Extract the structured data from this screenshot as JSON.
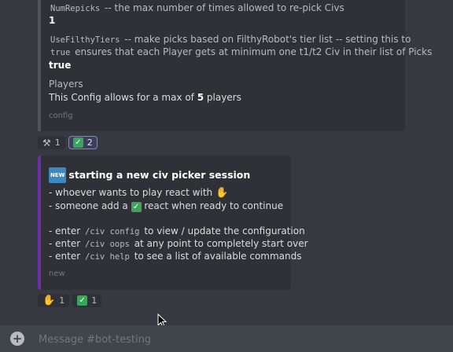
{
  "embed1": {
    "line1_code": "NumRepicks",
    "line1_text": " -- the max number of times allowed to re-pick Civs",
    "line1_value": "1",
    "line2_code": "UseFilthyTiers",
    "line2_text": " -- make picks based on FilthyRobot's tier list -- setting this to",
    "line3_code": "true",
    "line3_text": " ensures that each Player gets at minimum one t1/t2 Civ in their list of Picks",
    "line3_value": "true",
    "players_label": "Players",
    "players_pre": "This Config allows for a max of ",
    "players_num": "5",
    "players_post": " players",
    "footer": "config"
  },
  "reactions1": [
    {
      "icon": "tools-icon",
      "count": "1"
    },
    {
      "icon": "check-icon",
      "count": "2"
    }
  ],
  "embed2": {
    "badge": "NEW",
    "title": "starting a new civ picker session",
    "l1": "- whoever wants to play react with ",
    "l2a": "- someone add a ",
    "l2b": " react when ready to continue",
    "l3a": "- enter ",
    "l3code": "/civ config",
    "l3b": " to view / update the configuration",
    "l4a": "- enter ",
    "l4code": "/civ oops",
    "l4b": " at any point to completely start over",
    "l5a": "- enter ",
    "l5code": "/civ help",
    "l5b": " to see a list of available commands",
    "footer": "new"
  },
  "reactions2": [
    {
      "icon": "raised-hand-icon",
      "count": "1"
    },
    {
      "icon": "check-icon",
      "count": "1"
    }
  ],
  "chat": {
    "placeholder": "Message #bot-testing"
  },
  "colors": {
    "background": "#36393f",
    "embed": "#2f3136",
    "accent": "#6f2da8",
    "check": "#3ba55c"
  }
}
